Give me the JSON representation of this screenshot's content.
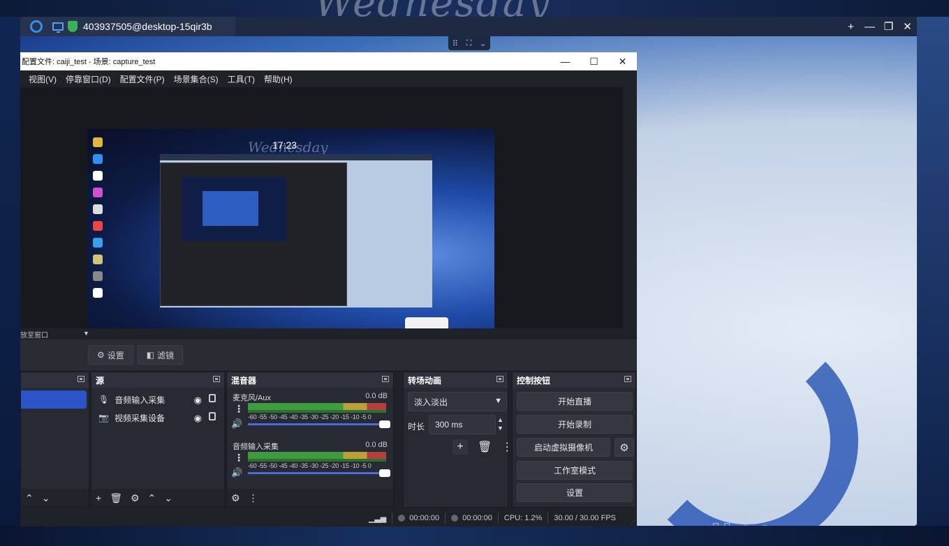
{
  "desktop": {
    "top_watermark": "Wednesday",
    "bottom_watermark": "▯▯ ○ ○"
  },
  "remote": {
    "session_title": "403937505@desktop-15qir3b",
    "controls": [
      "+",
      "—",
      "❐",
      "✕"
    ],
    "float_toolbar": [
      "⠿",
      "⛶",
      "⌄"
    ]
  },
  "obs": {
    "window_title": "配置文件: caiji_test - 场景: capture_test",
    "window_controls": [
      "—",
      "☐",
      "✕"
    ],
    "menu": [
      "视图(V)",
      "停靠窗口(D)",
      "配置文件(P)",
      "场景集合(S)",
      "工具(T)",
      "帮助(H)"
    ],
    "preview": {
      "clock": "17:23",
      "watermark": "Wednesday"
    },
    "dock_label": "放至窗口",
    "toolbar": {
      "settings_label": "设置",
      "filters_label": "滤镜"
    },
    "sources": {
      "title": "源",
      "items": [
        {
          "icon": "mic-icon",
          "label": "音频输入采集"
        },
        {
          "icon": "camera-icon",
          "label": "视频采集设备"
        }
      ]
    },
    "mixer": {
      "title": "混音器",
      "channels": [
        {
          "name": "麦克风/Aux",
          "db": "0.0 dB"
        },
        {
          "name": "音频输入采集",
          "db": "0.0 dB"
        }
      ],
      "scale": "-60 -55 -50 -45 -40 -35 -30 -25 -20 -15 -10 -5  0"
    },
    "transitions": {
      "title": "转场动画",
      "selected": "淡入淡出",
      "duration_label": "时长",
      "duration_value": "300 ms"
    },
    "controls": {
      "title": "控制按钮",
      "start_stream": "开始直播",
      "start_record": "开始录制",
      "virtual_cam": "启动虚拟摄像机",
      "studio_mode": "工作室模式",
      "settings": "设置"
    },
    "status": {
      "stream_time": "00:00:00",
      "record_time": "00:00:00",
      "cpu": "CPU: 1.2%",
      "fps": "30.00 / 30.00 FPS"
    }
  },
  "colors": {
    "accent": "#2c54c6",
    "panel": "#272a33",
    "shield_green": "#3bb15a"
  }
}
